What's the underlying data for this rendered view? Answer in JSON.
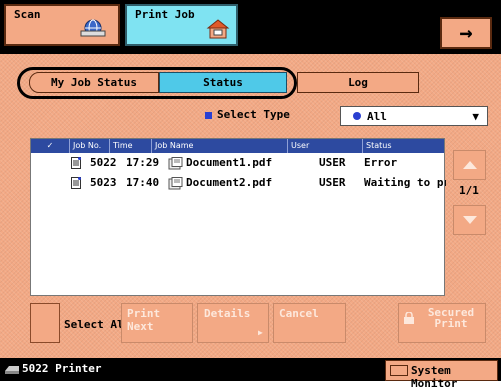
{
  "tabs": {
    "scan": "Scan",
    "print_job": "Print Job"
  },
  "next_arrow": "→",
  "segments": {
    "my_job_status": "My Job Status",
    "status": "Status",
    "log": "Log"
  },
  "select_type": {
    "label": "Select Type",
    "value": "All"
  },
  "table": {
    "headers": {
      "check": "✓",
      "job_no": "Job No.",
      "time": "Time",
      "job_name": "Job Name",
      "user": "User",
      "status": "Status"
    },
    "rows": [
      {
        "job_no": "5022",
        "time": "17:29",
        "job_name": "Document1.pdf",
        "user": "USER",
        "status": "Error"
      },
      {
        "job_no": "5023",
        "time": "17:40",
        "job_name": "Document2.pdf",
        "user": "USER",
        "status": "Waiting to print."
      }
    ]
  },
  "page_indicator": "1/1",
  "buttons": {
    "select_all": "Select All",
    "print_next": "Print Next",
    "details": "Details",
    "cancel": "Cancel",
    "secured_print": "Secured Print"
  },
  "status_bar": {
    "printer": "5022 Printer",
    "system_monitor": "System Monitor"
  },
  "colors": {
    "accent_orange": "#f3a985",
    "status_tab": "#4fc9e8",
    "print_job_tab": "#7fe3f2",
    "header_blue": "#2d4aa0"
  }
}
